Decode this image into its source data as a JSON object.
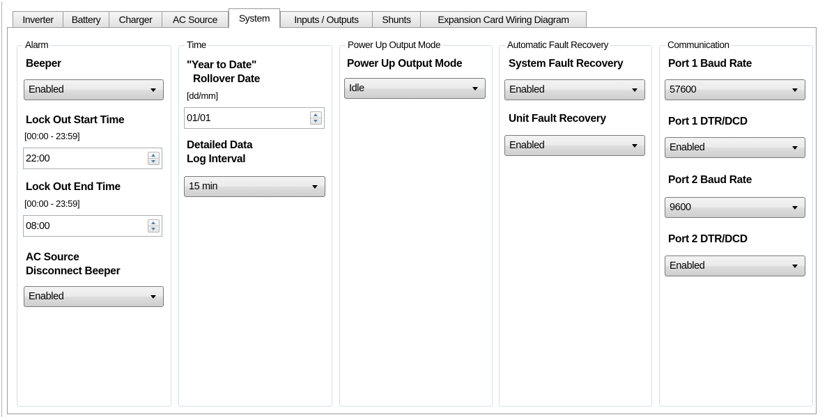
{
  "tabs": [
    {
      "label": "Inverter"
    },
    {
      "label": "Battery"
    },
    {
      "label": "Charger"
    },
    {
      "label": "AC Source"
    },
    {
      "label": "System"
    },
    {
      "label": "Inputs / Outputs"
    },
    {
      "label": "Shunts"
    },
    {
      "label": "Expansion Card Wiring Diagram"
    }
  ],
  "active_tab": "System",
  "alarm": {
    "title": "Alarm",
    "beeper_label": "Beeper",
    "beeper_value": "Enabled",
    "lockout_start_label": "Lock Out Start Time",
    "lockout_start_range": "[00:00 - 23:59]",
    "lockout_start_value": "22:00",
    "lockout_end_label": "Lock Out End Time",
    "lockout_end_range": "[00:00 - 23:59]",
    "lockout_end_value": "08:00",
    "ac_disconnect_label_line1": "AC Source",
    "ac_disconnect_label_line2": "Disconnect Beeper",
    "ac_disconnect_value": "Enabled"
  },
  "time": {
    "title": "Time",
    "rollover_label_line1": "\"Year to Date\"",
    "rollover_label_line2": "Rollover Date",
    "rollover_format": "[dd/mm]",
    "rollover_value": "01/01",
    "log_interval_label_line1": "Detailed Data",
    "log_interval_label_line2": "Log Interval",
    "log_interval_value": "15 min"
  },
  "power_up": {
    "title": "Power Up Output Mode",
    "mode_label": "Power Up Output Mode",
    "mode_value": "Idle"
  },
  "fault_recovery": {
    "title": "Automatic Fault Recovery",
    "system_label": "System Fault Recovery",
    "system_value": "Enabled",
    "unit_label": "Unit Fault Recovery",
    "unit_value": "Enabled"
  },
  "communication": {
    "title": "Communication",
    "port1_baud_label": "Port 1 Baud Rate",
    "port1_baud_value": "57600",
    "port1_dtr_label": "Port 1 DTR/DCD",
    "port1_dtr_value": "Enabled",
    "port2_baud_label": "Port 2 Baud Rate",
    "port2_baud_value": "9600",
    "port2_dtr_label": "Port 2 DTR/DCD",
    "port2_dtr_value": "Enabled"
  },
  "icons": {
    "dropdown_arrow": "chevron-down-icon",
    "spin_up": "spin-up-icon",
    "spin_down": "spin-down-icon"
  }
}
